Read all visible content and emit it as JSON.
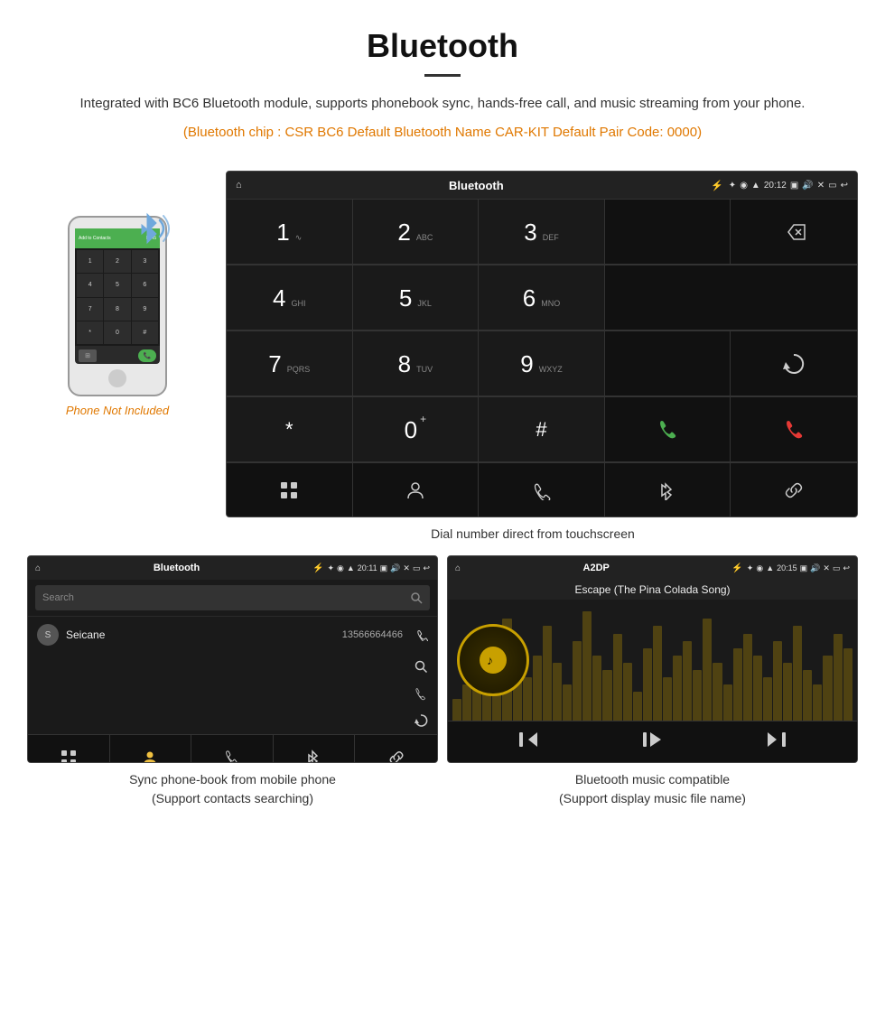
{
  "header": {
    "title": "Bluetooth",
    "description": "Integrated with BC6 Bluetooth module, supports phonebook sync, hands-free call, and music streaming from your phone.",
    "specs": "(Bluetooth chip : CSR BC6    Default Bluetooth Name CAR-KIT    Default Pair Code: 0000)"
  },
  "phone_note": "Phone Not Included",
  "dial_screen": {
    "status_bar": {
      "home_icon": "⌂",
      "title": "Bluetooth",
      "usb_icon": "⚡",
      "bt_icon": "✦",
      "location_icon": "◉",
      "signal_icon": "▲",
      "time": "20:12",
      "camera_icon": "📷",
      "volume_icon": "🔊",
      "close_icon": "✕",
      "window_icon": "▭",
      "back_icon": "↩"
    },
    "keys": [
      {
        "number": "1",
        "sub": ""
      },
      {
        "number": "2",
        "sub": "ABC"
      },
      {
        "number": "3",
        "sub": "DEF"
      },
      {
        "number": "",
        "sub": ""
      },
      {
        "number": "⌫",
        "sub": ""
      },
      {
        "number": "4",
        "sub": "GHI"
      },
      {
        "number": "5",
        "sub": "JKL"
      },
      {
        "number": "6",
        "sub": "MNO"
      },
      {
        "number": "",
        "sub": ""
      },
      {
        "number": "",
        "sub": ""
      },
      {
        "number": "7",
        "sub": "PQRS"
      },
      {
        "number": "8",
        "sub": "TUV"
      },
      {
        "number": "9",
        "sub": "WXYZ"
      },
      {
        "number": "",
        "sub": ""
      },
      {
        "number": "↻",
        "sub": ""
      },
      {
        "number": "*",
        "sub": ""
      },
      {
        "number": "0+",
        "sub": ""
      },
      {
        "number": "#",
        "sub": ""
      },
      {
        "number": "📞",
        "sub": "green"
      },
      {
        "number": "",
        "sub": ""
      },
      {
        "number": "📵",
        "sub": "red"
      }
    ],
    "toolbar": {
      "grid_icon": "⊞",
      "person_icon": "👤",
      "phone_icon": "📞",
      "bt_icon": "✦",
      "link_icon": "🔗"
    }
  },
  "dial_caption": "Dial number direct from touchscreen",
  "phonebook_screen": {
    "status_bar": {
      "home_icon": "⌂",
      "title": "Bluetooth",
      "usb_icon": "⚡"
    },
    "search_placeholder": "Search",
    "contacts": [
      {
        "initial": "S",
        "name": "Seicane",
        "number": "13566664466"
      }
    ]
  },
  "phonebook_caption_line1": "Sync phone-book from mobile phone",
  "phonebook_caption_line2": "(Support contacts searching)",
  "music_screen": {
    "status_bar": {
      "title": "A2DP"
    },
    "song_title": "Escape (The Pina Colada Song)",
    "controls": {
      "rewind": "⏮",
      "play_pause": "⏯",
      "forward": "⏭"
    },
    "visualizer_bars": [
      3,
      5,
      8,
      12,
      7,
      14,
      10,
      6,
      9,
      13,
      8,
      5,
      11,
      15,
      9,
      7,
      12,
      8,
      4,
      10,
      13,
      6,
      9,
      11,
      7,
      14,
      8,
      5,
      10,
      12,
      9,
      6,
      11,
      8,
      13,
      7,
      5,
      9,
      12,
      10
    ]
  },
  "music_caption_line1": "Bluetooth music compatible",
  "music_caption_line2": "(Support display music file name)"
}
